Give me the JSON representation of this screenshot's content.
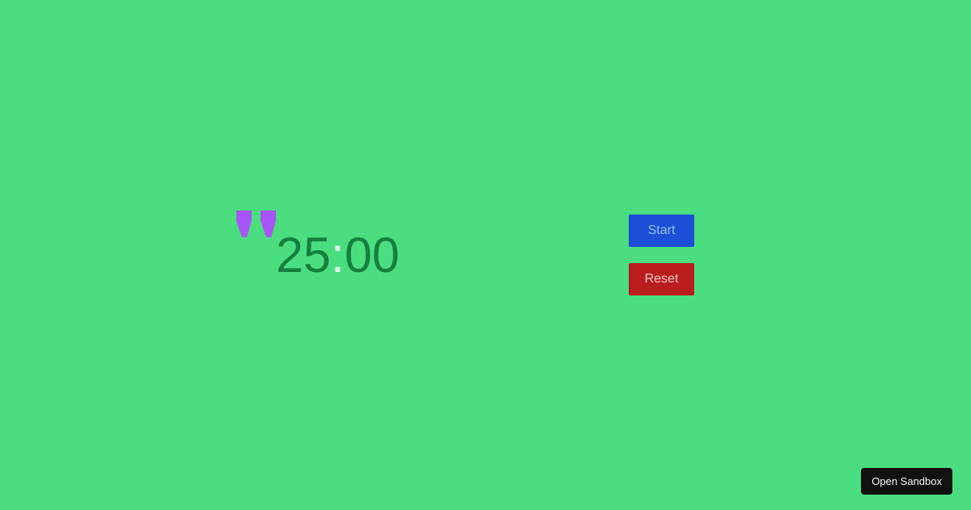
{
  "timer": {
    "minutes": "25",
    "separator": ":",
    "seconds": "00",
    "icon": "quote-icon"
  },
  "controls": {
    "start_label": "Start",
    "reset_label": "Reset"
  },
  "footer": {
    "open_sandbox_label": "Open Sandbox"
  },
  "colors": {
    "background": "#4ade80",
    "timer_text": "#15803d",
    "timer_separator": "#dcfce7",
    "icon": "#a855f7",
    "start_button": "#1d4ed8",
    "reset_button": "#b91c1c",
    "sandbox_button": "#111111"
  }
}
